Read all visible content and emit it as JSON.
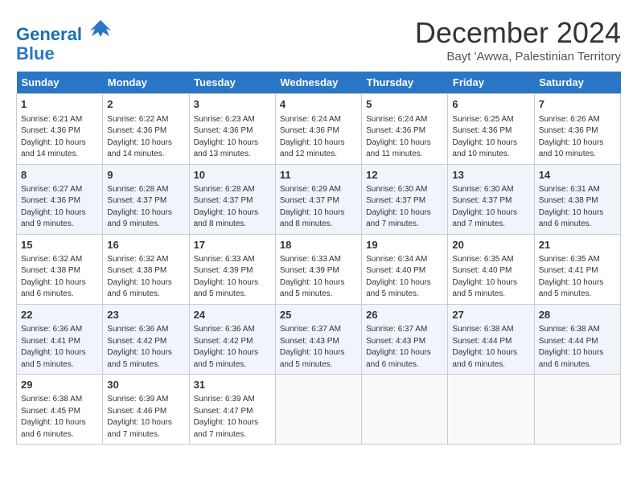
{
  "logo": {
    "line1": "General",
    "line2": "Blue"
  },
  "title": "December 2024",
  "subtitle": "Bayt 'Awwa, Palestinian Territory",
  "days_of_week": [
    "Sunday",
    "Monday",
    "Tuesday",
    "Wednesday",
    "Thursday",
    "Friday",
    "Saturday"
  ],
  "weeks": [
    [
      {
        "day": "1",
        "info": "Sunrise: 6:21 AM\nSunset: 4:36 PM\nDaylight: 10 hours and 14 minutes."
      },
      {
        "day": "2",
        "info": "Sunrise: 6:22 AM\nSunset: 4:36 PM\nDaylight: 10 hours and 14 minutes."
      },
      {
        "day": "3",
        "info": "Sunrise: 6:23 AM\nSunset: 4:36 PM\nDaylight: 10 hours and 13 minutes."
      },
      {
        "day": "4",
        "info": "Sunrise: 6:24 AM\nSunset: 4:36 PM\nDaylight: 10 hours and 12 minutes."
      },
      {
        "day": "5",
        "info": "Sunrise: 6:24 AM\nSunset: 4:36 PM\nDaylight: 10 hours and 11 minutes."
      },
      {
        "day": "6",
        "info": "Sunrise: 6:25 AM\nSunset: 4:36 PM\nDaylight: 10 hours and 10 minutes."
      },
      {
        "day": "7",
        "info": "Sunrise: 6:26 AM\nSunset: 4:36 PM\nDaylight: 10 hours and 10 minutes."
      }
    ],
    [
      {
        "day": "8",
        "info": "Sunrise: 6:27 AM\nSunset: 4:36 PM\nDaylight: 10 hours and 9 minutes."
      },
      {
        "day": "9",
        "info": "Sunrise: 6:28 AM\nSunset: 4:37 PM\nDaylight: 10 hours and 9 minutes."
      },
      {
        "day": "10",
        "info": "Sunrise: 6:28 AM\nSunset: 4:37 PM\nDaylight: 10 hours and 8 minutes."
      },
      {
        "day": "11",
        "info": "Sunrise: 6:29 AM\nSunset: 4:37 PM\nDaylight: 10 hours and 8 minutes."
      },
      {
        "day": "12",
        "info": "Sunrise: 6:30 AM\nSunset: 4:37 PM\nDaylight: 10 hours and 7 minutes."
      },
      {
        "day": "13",
        "info": "Sunrise: 6:30 AM\nSunset: 4:37 PM\nDaylight: 10 hours and 7 minutes."
      },
      {
        "day": "14",
        "info": "Sunrise: 6:31 AM\nSunset: 4:38 PM\nDaylight: 10 hours and 6 minutes."
      }
    ],
    [
      {
        "day": "15",
        "info": "Sunrise: 6:32 AM\nSunset: 4:38 PM\nDaylight: 10 hours and 6 minutes."
      },
      {
        "day": "16",
        "info": "Sunrise: 6:32 AM\nSunset: 4:38 PM\nDaylight: 10 hours and 6 minutes."
      },
      {
        "day": "17",
        "info": "Sunrise: 6:33 AM\nSunset: 4:39 PM\nDaylight: 10 hours and 5 minutes."
      },
      {
        "day": "18",
        "info": "Sunrise: 6:33 AM\nSunset: 4:39 PM\nDaylight: 10 hours and 5 minutes."
      },
      {
        "day": "19",
        "info": "Sunrise: 6:34 AM\nSunset: 4:40 PM\nDaylight: 10 hours and 5 minutes."
      },
      {
        "day": "20",
        "info": "Sunrise: 6:35 AM\nSunset: 4:40 PM\nDaylight: 10 hours and 5 minutes."
      },
      {
        "day": "21",
        "info": "Sunrise: 6:35 AM\nSunset: 4:41 PM\nDaylight: 10 hours and 5 minutes."
      }
    ],
    [
      {
        "day": "22",
        "info": "Sunrise: 6:36 AM\nSunset: 4:41 PM\nDaylight: 10 hours and 5 minutes."
      },
      {
        "day": "23",
        "info": "Sunrise: 6:36 AM\nSunset: 4:42 PM\nDaylight: 10 hours and 5 minutes."
      },
      {
        "day": "24",
        "info": "Sunrise: 6:36 AM\nSunset: 4:42 PM\nDaylight: 10 hours and 5 minutes."
      },
      {
        "day": "25",
        "info": "Sunrise: 6:37 AM\nSunset: 4:43 PM\nDaylight: 10 hours and 5 minutes."
      },
      {
        "day": "26",
        "info": "Sunrise: 6:37 AM\nSunset: 4:43 PM\nDaylight: 10 hours and 6 minutes."
      },
      {
        "day": "27",
        "info": "Sunrise: 6:38 AM\nSunset: 4:44 PM\nDaylight: 10 hours and 6 minutes."
      },
      {
        "day": "28",
        "info": "Sunrise: 6:38 AM\nSunset: 4:44 PM\nDaylight: 10 hours and 6 minutes."
      }
    ],
    [
      {
        "day": "29",
        "info": "Sunrise: 6:38 AM\nSunset: 4:45 PM\nDaylight: 10 hours and 6 minutes."
      },
      {
        "day": "30",
        "info": "Sunrise: 6:39 AM\nSunset: 4:46 PM\nDaylight: 10 hours and 7 minutes."
      },
      {
        "day": "31",
        "info": "Sunrise: 6:39 AM\nSunset: 4:47 PM\nDaylight: 10 hours and 7 minutes."
      },
      {
        "day": "",
        "info": ""
      },
      {
        "day": "",
        "info": ""
      },
      {
        "day": "",
        "info": ""
      },
      {
        "day": "",
        "info": ""
      }
    ]
  ]
}
